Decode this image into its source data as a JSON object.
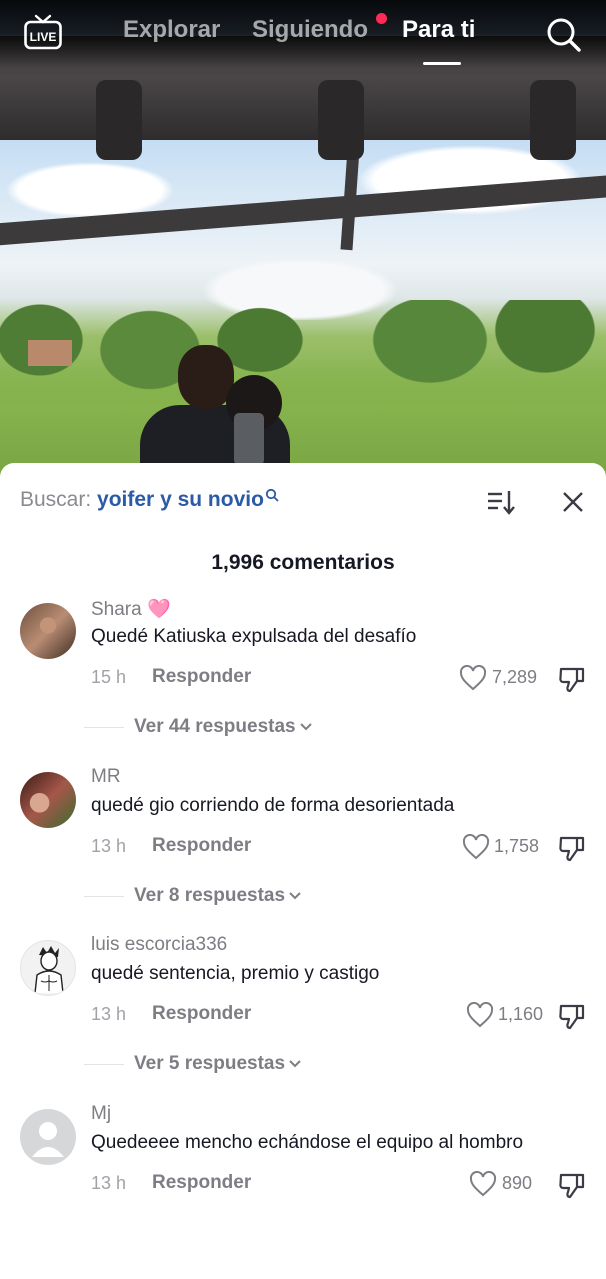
{
  "nav": {
    "live_label": "LIVE",
    "tabs": [
      {
        "label": "Explorar",
        "active": false
      },
      {
        "label": "Siguiendo",
        "active": false,
        "has_dot": true
      },
      {
        "label": "Para ti",
        "active": true
      }
    ]
  },
  "comments_panel": {
    "search_label": "Buscar:",
    "search_query": "yoifer y su novio",
    "count_label": "1,996 comentarios",
    "comments": [
      {
        "username": "Shara 🩷",
        "text": "Quedé Katiuska expulsada del desafío",
        "time": "15 h",
        "reply_label": "Responder",
        "likes": "7,289",
        "view_replies": "Ver 44 respuestas"
      },
      {
        "username": "MR",
        "text": "quedé gio corriendo de forma desorientada",
        "time": "13 h",
        "reply_label": "Responder",
        "likes": "1,758",
        "view_replies": "Ver 8 respuestas"
      },
      {
        "username": "luis escorcia336",
        "text": "quedé sentencia, premio y castigo",
        "time": "13 h",
        "reply_label": "Responder",
        "likes": "1,160",
        "view_replies": "Ver 5 respuestas"
      },
      {
        "username": "Mj",
        "text": "Quedeeee mencho echándose el equipo al hombro",
        "time": "13 h",
        "reply_label": "Responder",
        "likes": "890"
      }
    ]
  },
  "colors": {
    "accent_dot": "#fe2c55",
    "search_query": "#2b5aa6",
    "text_primary": "#161823",
    "text_secondary": "#7d7e84"
  },
  "icons": [
    "live-icon",
    "search-icon",
    "sort-icon",
    "close-icon",
    "heart-icon",
    "dislike-icon",
    "chevron-down-icon"
  ]
}
